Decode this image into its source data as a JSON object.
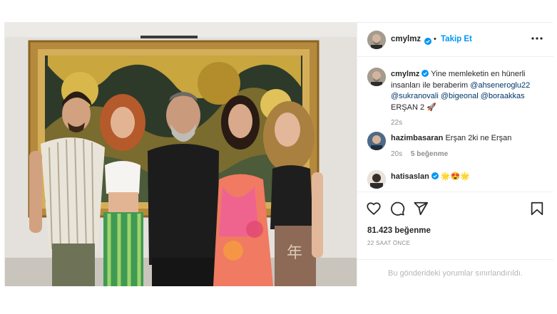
{
  "post": {
    "author": "cmylmz",
    "separator": "•",
    "follow_label": "Takip Et",
    "image_alt": "Five people posing together in front of a framed painting"
  },
  "caption": {
    "username": "cmylmz",
    "text": "Yine memleketin en hünerli insanları ile beraberim",
    "mentions": [
      "@ahseneroglu22",
      "@sukranovali",
      "@bigeonal",
      "@boraakkas"
    ],
    "tail": "ERŞAN 2",
    "rocket_emoji": "🚀",
    "time": "22s"
  },
  "comments": [
    {
      "username": "hazimbasaran",
      "text": "Erşan 2ki ne Erşan",
      "time": "20s",
      "likes": "5 beğenme"
    },
    {
      "username": "hatisaslan",
      "emoji": "🌟😍🌟"
    }
  ],
  "engagement": {
    "likes": "81.423 beğenme",
    "time_ago": "22 SAAT ÖNCE"
  },
  "footer": {
    "restricted_text": "Bu gönderideki yorumlar sınırlandırıldı."
  },
  "icons": {
    "verified": "verified-badge-icon",
    "more": "more-options-icon",
    "like": "heart-icon",
    "comment": "comment-icon",
    "share": "share-icon",
    "save": "bookmark-icon"
  },
  "colors": {
    "accent": "#0095f6",
    "mention": "#00376b",
    "muted": "#8e8e8e",
    "text": "#262626"
  }
}
